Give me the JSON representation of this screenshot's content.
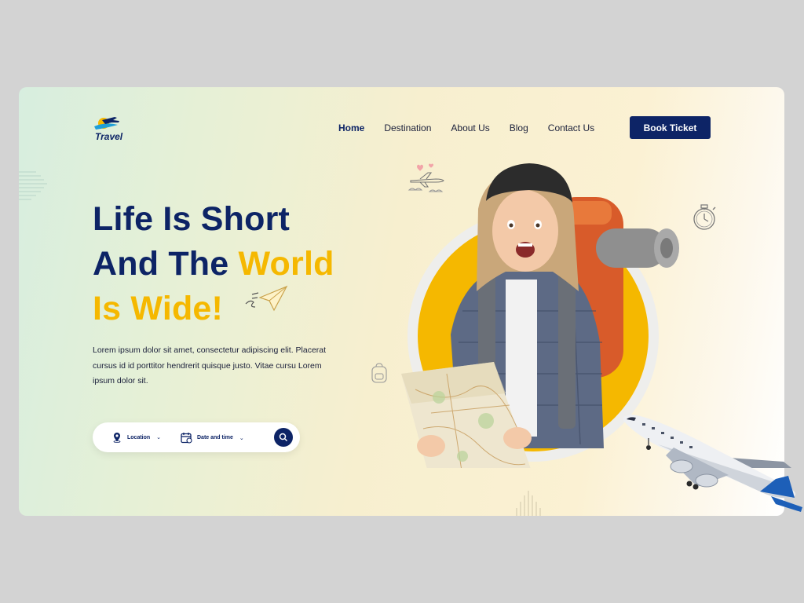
{
  "brand": {
    "name": "Travel"
  },
  "nav": {
    "items": [
      {
        "label": "Home",
        "active": true
      },
      {
        "label": "Destination",
        "active": false
      },
      {
        "label": "About Us",
        "active": false
      },
      {
        "label": "Blog",
        "active": false
      },
      {
        "label": "Contact Us",
        "active": false
      }
    ],
    "cta_label": "Book Ticket"
  },
  "hero": {
    "line1": "Life Is Short",
    "line2a": "And The ",
    "line2b": "World",
    "line3": "Is Wide!",
    "paragraph": "Lorem ipsum dolor sit amet, consectetur adipiscing elit. Placerat cursus id id porttitor hendrerit quisque justo. Vitae cursu Lorem ipsum dolor sit."
  },
  "search": {
    "location_label": "Location",
    "date_label": "Date and time",
    "icons": [
      "location-pin-icon",
      "calendar-icon",
      "search-icon"
    ]
  },
  "colors": {
    "navy": "#0d2466",
    "accent_yellow": "#f5b800",
    "page_bg": "#d3d3d3"
  }
}
